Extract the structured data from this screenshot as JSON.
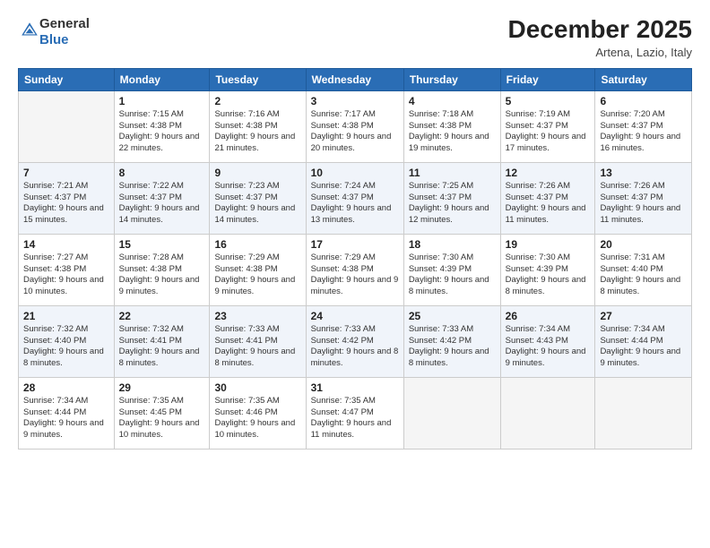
{
  "logo": {
    "general": "General",
    "blue": "Blue"
  },
  "title": "December 2025",
  "location": "Artena, Lazio, Italy",
  "weekdays": [
    "Sunday",
    "Monday",
    "Tuesday",
    "Wednesday",
    "Thursday",
    "Friday",
    "Saturday"
  ],
  "weeks": [
    [
      {
        "day": "",
        "sunrise": "",
        "sunset": "",
        "daylight": ""
      },
      {
        "day": "1",
        "sunrise": "Sunrise: 7:15 AM",
        "sunset": "Sunset: 4:38 PM",
        "daylight": "Daylight: 9 hours and 22 minutes."
      },
      {
        "day": "2",
        "sunrise": "Sunrise: 7:16 AM",
        "sunset": "Sunset: 4:38 PM",
        "daylight": "Daylight: 9 hours and 21 minutes."
      },
      {
        "day": "3",
        "sunrise": "Sunrise: 7:17 AM",
        "sunset": "Sunset: 4:38 PM",
        "daylight": "Daylight: 9 hours and 20 minutes."
      },
      {
        "day": "4",
        "sunrise": "Sunrise: 7:18 AM",
        "sunset": "Sunset: 4:38 PM",
        "daylight": "Daylight: 9 hours and 19 minutes."
      },
      {
        "day": "5",
        "sunrise": "Sunrise: 7:19 AM",
        "sunset": "Sunset: 4:37 PM",
        "daylight": "Daylight: 9 hours and 17 minutes."
      },
      {
        "day": "6",
        "sunrise": "Sunrise: 7:20 AM",
        "sunset": "Sunset: 4:37 PM",
        "daylight": "Daylight: 9 hours and 16 minutes."
      }
    ],
    [
      {
        "day": "7",
        "sunrise": "Sunrise: 7:21 AM",
        "sunset": "Sunset: 4:37 PM",
        "daylight": "Daylight: 9 hours and 15 minutes."
      },
      {
        "day": "8",
        "sunrise": "Sunrise: 7:22 AM",
        "sunset": "Sunset: 4:37 PM",
        "daylight": "Daylight: 9 hours and 14 minutes."
      },
      {
        "day": "9",
        "sunrise": "Sunrise: 7:23 AM",
        "sunset": "Sunset: 4:37 PM",
        "daylight": "Daylight: 9 hours and 14 minutes."
      },
      {
        "day": "10",
        "sunrise": "Sunrise: 7:24 AM",
        "sunset": "Sunset: 4:37 PM",
        "daylight": "Daylight: 9 hours and 13 minutes."
      },
      {
        "day": "11",
        "sunrise": "Sunrise: 7:25 AM",
        "sunset": "Sunset: 4:37 PM",
        "daylight": "Daylight: 9 hours and 12 minutes."
      },
      {
        "day": "12",
        "sunrise": "Sunrise: 7:26 AM",
        "sunset": "Sunset: 4:37 PM",
        "daylight": "Daylight: 9 hours and 11 minutes."
      },
      {
        "day": "13",
        "sunrise": "Sunrise: 7:26 AM",
        "sunset": "Sunset: 4:37 PM",
        "daylight": "Daylight: 9 hours and 11 minutes."
      }
    ],
    [
      {
        "day": "14",
        "sunrise": "Sunrise: 7:27 AM",
        "sunset": "Sunset: 4:38 PM",
        "daylight": "Daylight: 9 hours and 10 minutes."
      },
      {
        "day": "15",
        "sunrise": "Sunrise: 7:28 AM",
        "sunset": "Sunset: 4:38 PM",
        "daylight": "Daylight: 9 hours and 9 minutes."
      },
      {
        "day": "16",
        "sunrise": "Sunrise: 7:29 AM",
        "sunset": "Sunset: 4:38 PM",
        "daylight": "Daylight: 9 hours and 9 minutes."
      },
      {
        "day": "17",
        "sunrise": "Sunrise: 7:29 AM",
        "sunset": "Sunset: 4:38 PM",
        "daylight": "Daylight: 9 hours and 9 minutes."
      },
      {
        "day": "18",
        "sunrise": "Sunrise: 7:30 AM",
        "sunset": "Sunset: 4:39 PM",
        "daylight": "Daylight: 9 hours and 8 minutes."
      },
      {
        "day": "19",
        "sunrise": "Sunrise: 7:30 AM",
        "sunset": "Sunset: 4:39 PM",
        "daylight": "Daylight: 9 hours and 8 minutes."
      },
      {
        "day": "20",
        "sunrise": "Sunrise: 7:31 AM",
        "sunset": "Sunset: 4:40 PM",
        "daylight": "Daylight: 9 hours and 8 minutes."
      }
    ],
    [
      {
        "day": "21",
        "sunrise": "Sunrise: 7:32 AM",
        "sunset": "Sunset: 4:40 PM",
        "daylight": "Daylight: 9 hours and 8 minutes."
      },
      {
        "day": "22",
        "sunrise": "Sunrise: 7:32 AM",
        "sunset": "Sunset: 4:41 PM",
        "daylight": "Daylight: 9 hours and 8 minutes."
      },
      {
        "day": "23",
        "sunrise": "Sunrise: 7:33 AM",
        "sunset": "Sunset: 4:41 PM",
        "daylight": "Daylight: 9 hours and 8 minutes."
      },
      {
        "day": "24",
        "sunrise": "Sunrise: 7:33 AM",
        "sunset": "Sunset: 4:42 PM",
        "daylight": "Daylight: 9 hours and 8 minutes."
      },
      {
        "day": "25",
        "sunrise": "Sunrise: 7:33 AM",
        "sunset": "Sunset: 4:42 PM",
        "daylight": "Daylight: 9 hours and 8 minutes."
      },
      {
        "day": "26",
        "sunrise": "Sunrise: 7:34 AM",
        "sunset": "Sunset: 4:43 PM",
        "daylight": "Daylight: 9 hours and 9 minutes."
      },
      {
        "day": "27",
        "sunrise": "Sunrise: 7:34 AM",
        "sunset": "Sunset: 4:44 PM",
        "daylight": "Daylight: 9 hours and 9 minutes."
      }
    ],
    [
      {
        "day": "28",
        "sunrise": "Sunrise: 7:34 AM",
        "sunset": "Sunset: 4:44 PM",
        "daylight": "Daylight: 9 hours and 9 minutes."
      },
      {
        "day": "29",
        "sunrise": "Sunrise: 7:35 AM",
        "sunset": "Sunset: 4:45 PM",
        "daylight": "Daylight: 9 hours and 10 minutes."
      },
      {
        "day": "30",
        "sunrise": "Sunrise: 7:35 AM",
        "sunset": "Sunset: 4:46 PM",
        "daylight": "Daylight: 9 hours and 10 minutes."
      },
      {
        "day": "31",
        "sunrise": "Sunrise: 7:35 AM",
        "sunset": "Sunset: 4:47 PM",
        "daylight": "Daylight: 9 hours and 11 minutes."
      },
      {
        "day": "",
        "sunrise": "",
        "sunset": "",
        "daylight": ""
      },
      {
        "day": "",
        "sunrise": "",
        "sunset": "",
        "daylight": ""
      },
      {
        "day": "",
        "sunrise": "",
        "sunset": "",
        "daylight": ""
      }
    ]
  ]
}
